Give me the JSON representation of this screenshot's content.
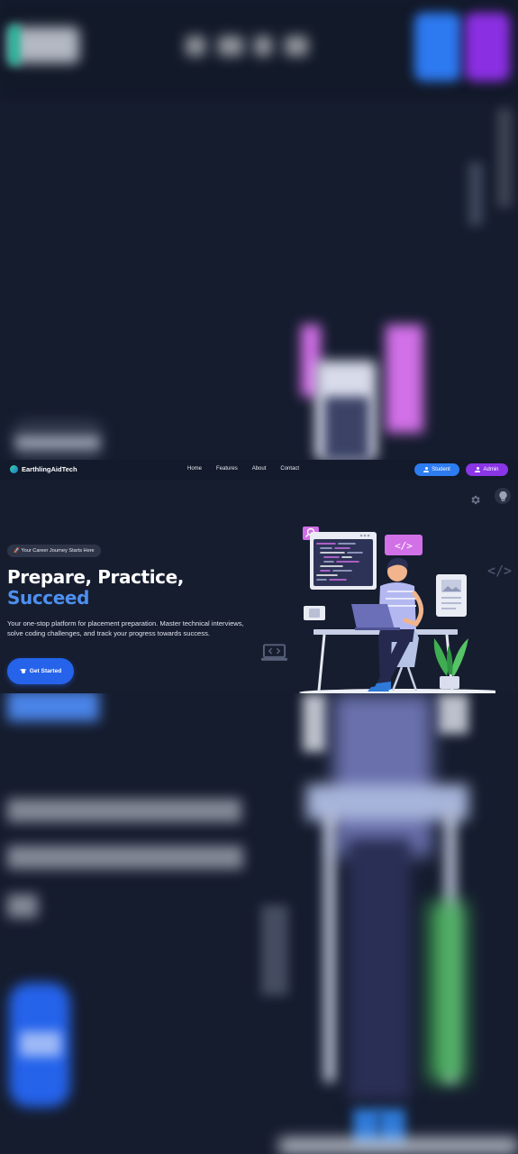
{
  "brand": {
    "name": "EarthlingAidTech"
  },
  "nav": {
    "links": [
      "Home",
      "Features",
      "About",
      "Contact"
    ]
  },
  "auth": {
    "student_label": "Student",
    "admin_label": "Admin"
  },
  "hero": {
    "badge": "🚀 Your Career Journey Starts Here",
    "title_line1": "Prepare, Practice,",
    "title_line2": "Succeed",
    "description": "Your one-stop platform for placement preparation. Master technical interviews, solve coding challenges, and track your progress towards success.",
    "cta_label": "Get Started"
  },
  "icons": [
    "settings-gear-icon",
    "lightbulb-icon",
    "code-brackets-icon",
    "laptop-code-icon",
    "graduation-cap-icon",
    "user-icon",
    "user-shield-icon"
  ],
  "colors": {
    "accent_blue": "#2563eb",
    "student_blue": "#2d7cf0",
    "admin_purple": "#8a35e6",
    "title_accent": "#4d8ff0",
    "background": "#161d2f"
  }
}
